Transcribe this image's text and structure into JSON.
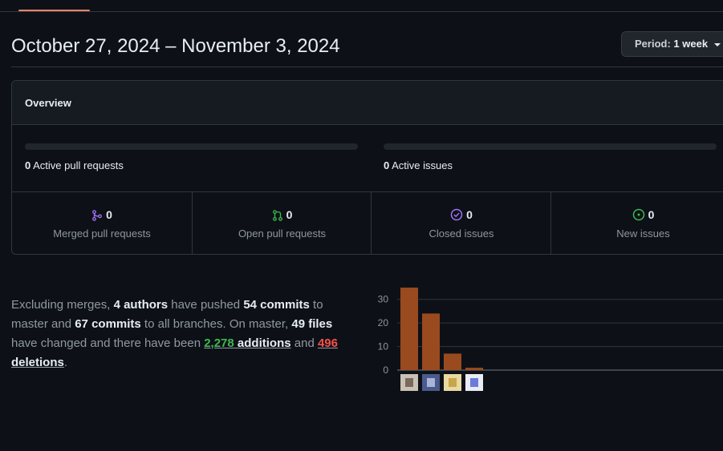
{
  "page": {
    "date_range": "October 27, 2024 – November 3, 2024",
    "period_label": "Period:",
    "period_value": "1 week"
  },
  "overview": {
    "title": "Overview",
    "active_prs": {
      "count": "0",
      "label": "Active pull requests"
    },
    "active_issues": {
      "count": "0",
      "label": "Active issues"
    },
    "stats": [
      {
        "count": "0",
        "label": "Merged pull requests",
        "icon": "merged-pr-icon",
        "color": "#a371f7"
      },
      {
        "count": "0",
        "label": "Open pull requests",
        "icon": "open-pr-icon",
        "color": "#3fb950"
      },
      {
        "count": "0",
        "label": "Closed issues",
        "icon": "closed-issue-icon",
        "color": "#a371f7"
      },
      {
        "count": "0",
        "label": "New issues",
        "icon": "new-issue-icon",
        "color": "#3fb950"
      }
    ]
  },
  "summary": {
    "t1": "Excluding merges, ",
    "authors": "4 authors",
    "t2": " have pushed ",
    "commits_master": "54 commits",
    "t3": " to master and ",
    "commits_all": "67 commits",
    "t4": " to all branches. On master, ",
    "files": "49 files",
    "t5": " have changed and there have been ",
    "additions_num": "2,278",
    "additions_word": " additions",
    "t6": " and ",
    "deletions_num": "496",
    "deletions_word": " deletions",
    "t7": "."
  },
  "chart_data": {
    "type": "bar",
    "categories": [
      "author-1",
      "author-2",
      "author-3",
      "author-4"
    ],
    "values": [
      35,
      24,
      7,
      1
    ],
    "ylim": [
      0,
      35
    ],
    "yticks": [
      0,
      10,
      20,
      30
    ],
    "bar_color": "#9a4a1f",
    "grid": true
  }
}
